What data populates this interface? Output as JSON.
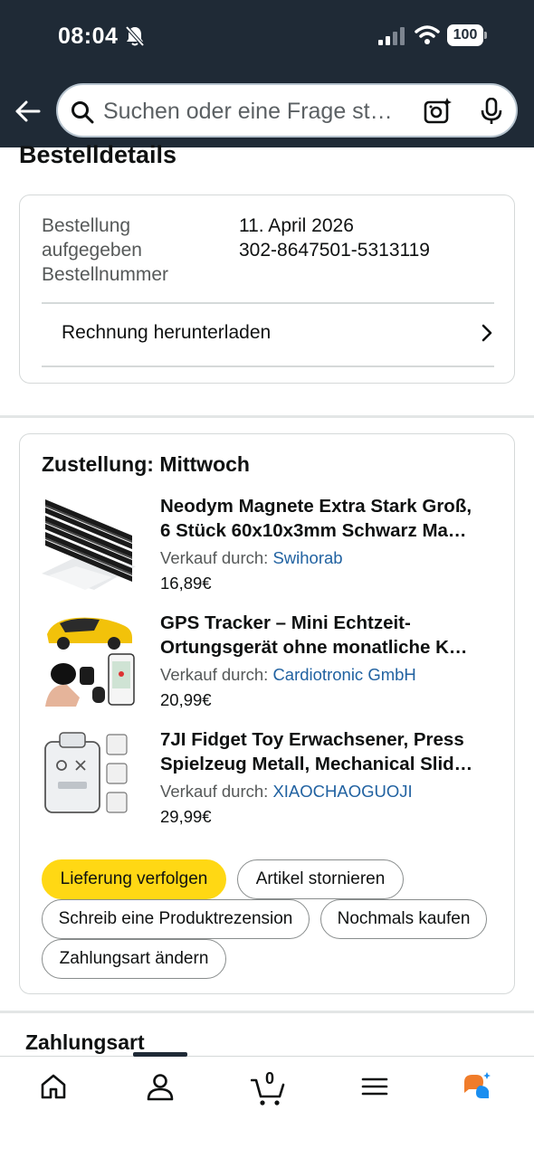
{
  "status_bar": {
    "time": "08:04",
    "battery": "100"
  },
  "search": {
    "placeholder": "Suchen oder eine Frage st…"
  },
  "page": {
    "title": "Bestelldetails"
  },
  "order": {
    "placed_label": "Bestellung aufgegeben",
    "placed_label_line1": "Bestellung",
    "placed_label_line2": "aufgegeben",
    "placed_value": "11. April 2026",
    "number_label": "Bestellnummer",
    "number_value": "302-8647501-5313119",
    "invoice_link": "Rechnung herunterladen"
  },
  "delivery": {
    "heading": "Zustellung: Mittwoch",
    "seller_prefix": "Verkauf durch:",
    "items": [
      {
        "title_line1": "Neodym Magnete Extra Stark Groß,",
        "title_line2": "6 Stück 60x10x3mm Schwarz Ma…",
        "seller": "Swihorab",
        "price": "16,89€"
      },
      {
        "title_line1": "GPS Tracker – Mini Echtzeit-",
        "title_line2": "Ortungsgerät ohne monatliche K…",
        "seller": "Cardiotronic GmbH",
        "price": "20,99€"
      },
      {
        "title_line1": "7JI Fidget Toy Erwachsener, Press",
        "title_line2": "Spielzeug Metall, Mechanical Slid…",
        "seller": "XIAOCHAOGUOJI",
        "price": "29,99€"
      }
    ],
    "actions": {
      "track": "Lieferung verfolgen",
      "cancel": "Artikel stornieren",
      "review": "Schreib eine Produktrezension",
      "buy_again": "Nochmals kaufen",
      "change_payment": "Zahlungsart ändern"
    }
  },
  "payment": {
    "heading": "Zahlungsart"
  },
  "bottom_nav": {
    "cart_count": "0"
  },
  "colors": {
    "header": "#1f2a36",
    "primary_button": "#ffd814",
    "link": "#2162a1"
  }
}
